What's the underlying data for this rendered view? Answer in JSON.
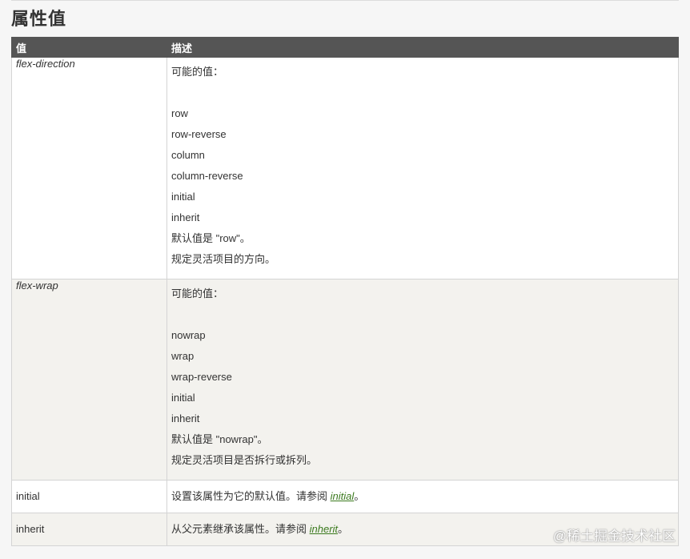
{
  "section_title": "属性值",
  "table": {
    "headers": [
      "值",
      "描述"
    ],
    "rows": [
      {
        "value": "flex-direction",
        "intro": "可能的值：",
        "options": [
          "row",
          "row-reverse",
          "column",
          "column-reverse",
          "initial",
          "inherit"
        ],
        "default_text": "默认值是 \"row\"。",
        "summary": "规定灵活项目的方向。"
      },
      {
        "value": "flex-wrap",
        "intro": "可能的值：",
        "options": [
          "nowrap",
          "wrap",
          "wrap-reverse",
          "initial",
          "inherit"
        ],
        "default_text": "默认值是 \"nowrap\"。",
        "summary": "规定灵活项目是否拆行或拆列。"
      },
      {
        "value": "initial",
        "desc_prefix": "设置该属性为它的默认值。请参阅 ",
        "link_text": "initial",
        "desc_suffix": "。"
      },
      {
        "value": "inherit",
        "desc_prefix": "从父元素继承该属性。请参阅 ",
        "link_text": "inherit",
        "desc_suffix": "。"
      }
    ]
  },
  "watermark": "@稀土掘金技术社区"
}
